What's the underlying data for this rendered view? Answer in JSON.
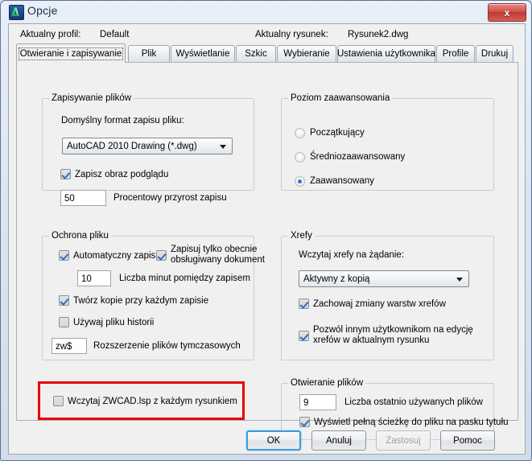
{
  "window": {
    "title": "Opcje",
    "icon": "zwcad-app-icon",
    "close_label": "x"
  },
  "header": {
    "profile_label": "Aktualny profil:",
    "profile_value": "Default",
    "drawing_label": "Aktualny rysunek:",
    "drawing_value": "Rysunek2.dwg"
  },
  "tabs": [
    {
      "label": "Otwieranie i zapisywanie",
      "active": true
    },
    {
      "label": "Plik",
      "active": false
    },
    {
      "label": "Wyświetlanie",
      "active": false
    },
    {
      "label": "Szkic",
      "active": false
    },
    {
      "label": "Wybieranie",
      "active": false
    },
    {
      "label": "Ustawienia użytkownika",
      "active": false
    },
    {
      "label": "Profile",
      "active": false
    },
    {
      "label": "Drukuj",
      "active": false
    }
  ],
  "groups": {
    "file_save": {
      "title": "Zapisywanie plików",
      "format_label": "Domyślny format zapisu pliku:",
      "format_value": "AutoCAD 2010 Drawing (*.dwg)",
      "preview_checkbox": "Zapisz obraz podglądu",
      "preview_checked": true,
      "percent_value": "50",
      "percent_label": "Procentowy przyrost zapisu"
    },
    "file_safety": {
      "title": "Ochrona pliku",
      "autosave_checkbox": "Automatyczny zapis",
      "autosave_checked": true,
      "current_doc_checkbox_line1": "Zapisuj tylko obecnie",
      "current_doc_checkbox_line2": "obsługiwany dokument",
      "current_doc_checked": true,
      "minutes_value": "10",
      "minutes_label": "Liczba minut pomiędzy zapisem",
      "backup_checkbox": "Twórz kopie przy każdym zapisie",
      "backup_checked": true,
      "log_checkbox": "Używaj pliku historii",
      "log_checked": false,
      "temp_ext_value": "zw$",
      "temp_ext_label": "Rozszerzenie plików tymczasowych"
    },
    "lisp": {
      "checkbox": "Wczytaj ZWCAD.lsp z każdym rysunkiem",
      "checked": false,
      "highlight_color": "#e90000"
    },
    "user_level": {
      "title": "Poziom zaawansowania",
      "options": [
        {
          "label": "Początkujący",
          "selected": false
        },
        {
          "label": "Średniozaawansowany",
          "selected": false
        },
        {
          "label": "Zaawansowany",
          "selected": true
        }
      ]
    },
    "xrefs": {
      "title": "Xrefy",
      "demand_load_label": "Wczytaj xrefy na żądanie:",
      "demand_load_value": "Aktywny z kopią",
      "retain_checkbox": "Zachowaj zmiany warstw xrefów",
      "retain_checked": true,
      "allow_checkbox_line1": "Pozwól innym użytkownikom na edycję",
      "allow_checkbox_line2": "xrefów w aktualnym rysunku",
      "allow_checked": true
    },
    "file_open": {
      "title": "Otwieranie plików",
      "recent_value": "9",
      "recent_label": "Liczba ostatnio używanych plików",
      "fullpath_checkbox": "Wyświetl pełną ścieżkę do pliku na pasku tytułu",
      "fullpath_checked": true
    }
  },
  "buttons": {
    "ok": "OK",
    "cancel": "Anuluj",
    "apply": "Zastosuj",
    "help": "Pomoc"
  }
}
